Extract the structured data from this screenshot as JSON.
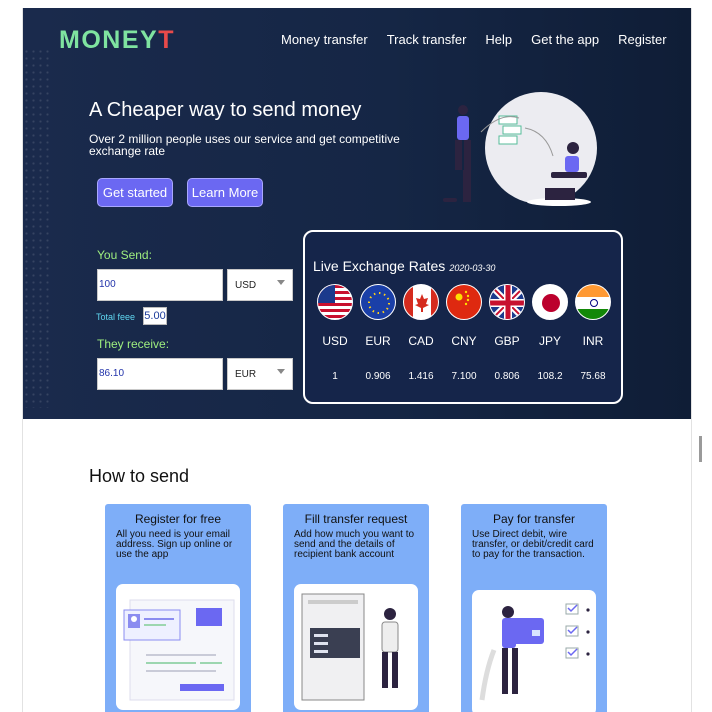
{
  "brand": {
    "name_main": "MONEY",
    "name_accent": "T"
  },
  "nav": [
    "Money transfer",
    "Track transfer",
    "Help",
    "Get the app",
    "Register"
  ],
  "hero": {
    "headline": "A Cheaper way to send money",
    "subline": "Over 2 million people uses our service and get competitive exchange rate",
    "get_started": "Get started",
    "learn_more": "Learn More"
  },
  "converter": {
    "send_label": "You Send:",
    "send_value": "100",
    "send_currency": "USD",
    "fee_label": "Total feee",
    "fee_value": "5.00",
    "receive_label": "They receive:",
    "receive_value": "86.10",
    "receive_currency": "EUR"
  },
  "rates": {
    "title": "Live Exchange Rates",
    "date": "2020-03-30",
    "items": [
      {
        "code": "USD",
        "rate": "1",
        "flag": "us-flag-icon"
      },
      {
        "code": "EUR",
        "rate": "0.906",
        "flag": "eu-flag-icon"
      },
      {
        "code": "CAD",
        "rate": "1.416",
        "flag": "canada-flag-icon"
      },
      {
        "code": "CNY",
        "rate": "7.100",
        "flag": "china-flag-icon"
      },
      {
        "code": "GBP",
        "rate": "0.806",
        "flag": "uk-flag-icon"
      },
      {
        "code": "JPY",
        "rate": "108.2",
        "flag": "japan-flag-icon"
      },
      {
        "code": "INR",
        "rate": "75.68",
        "flag": "india-flag-icon"
      }
    ]
  },
  "how": {
    "title": "How to send",
    "cards": [
      {
        "title": "Register for free",
        "text": "All you need is your email address. Sign up online or use the app"
      },
      {
        "title": "Fill transfer request",
        "text": "Add how much you want to send and the details of recipient bank account"
      },
      {
        "title": "Pay for transfer",
        "text": "Use Direct debit, wire transfer, or debit/credit card to pay for the transaction."
      }
    ]
  },
  "colors": {
    "hero_bg": "#152645",
    "accent_button": "#6b68f2",
    "logo_green": "#7fe3a0",
    "logo_red": "#e84a4a",
    "label_green": "#9ff07f",
    "card_blue": "#7eaef8"
  }
}
